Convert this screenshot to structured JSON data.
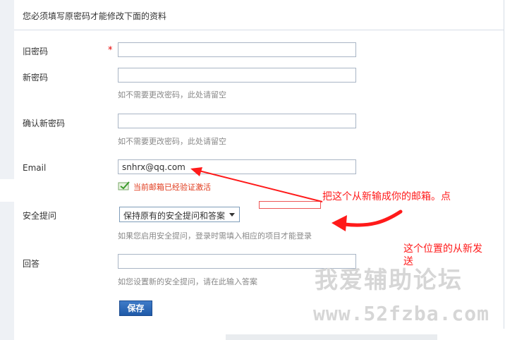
{
  "header": {
    "notice": "您必须填写原密码才能修改下面的资料"
  },
  "form": {
    "old_password": {
      "label": "旧密码",
      "required_mark": "*",
      "value": ""
    },
    "new_password": {
      "label": "新密码",
      "value": "",
      "hint": "如不需要更改密码，此处请留空"
    },
    "confirm_password": {
      "label": "确认新密码",
      "value": "",
      "hint": "如不需要更改密码，此处请留空"
    },
    "email": {
      "label": "Email",
      "value": "snhrx@qq.com",
      "status": "当前邮箱已经验证激活"
    },
    "security_question": {
      "label": "安全提问",
      "selected": "保持原有的安全提问和答案",
      "hint": "如果您启用安全提问，登录时需填入相应的项目才能登录"
    },
    "answer": {
      "label": "回答",
      "value": "",
      "hint": "如您设置新的安全提问，请在此输入答案"
    },
    "save_label": "保存"
  },
  "annotations": {
    "note1": "把这个从新输成你的邮箱。点",
    "note2_line1": "这个位置的从新发",
    "note2_line2": "送",
    "color": "#ff1a1a"
  },
  "watermark": {
    "cn": "我爱辅助论坛",
    "url": "www.52fzba.com"
  }
}
